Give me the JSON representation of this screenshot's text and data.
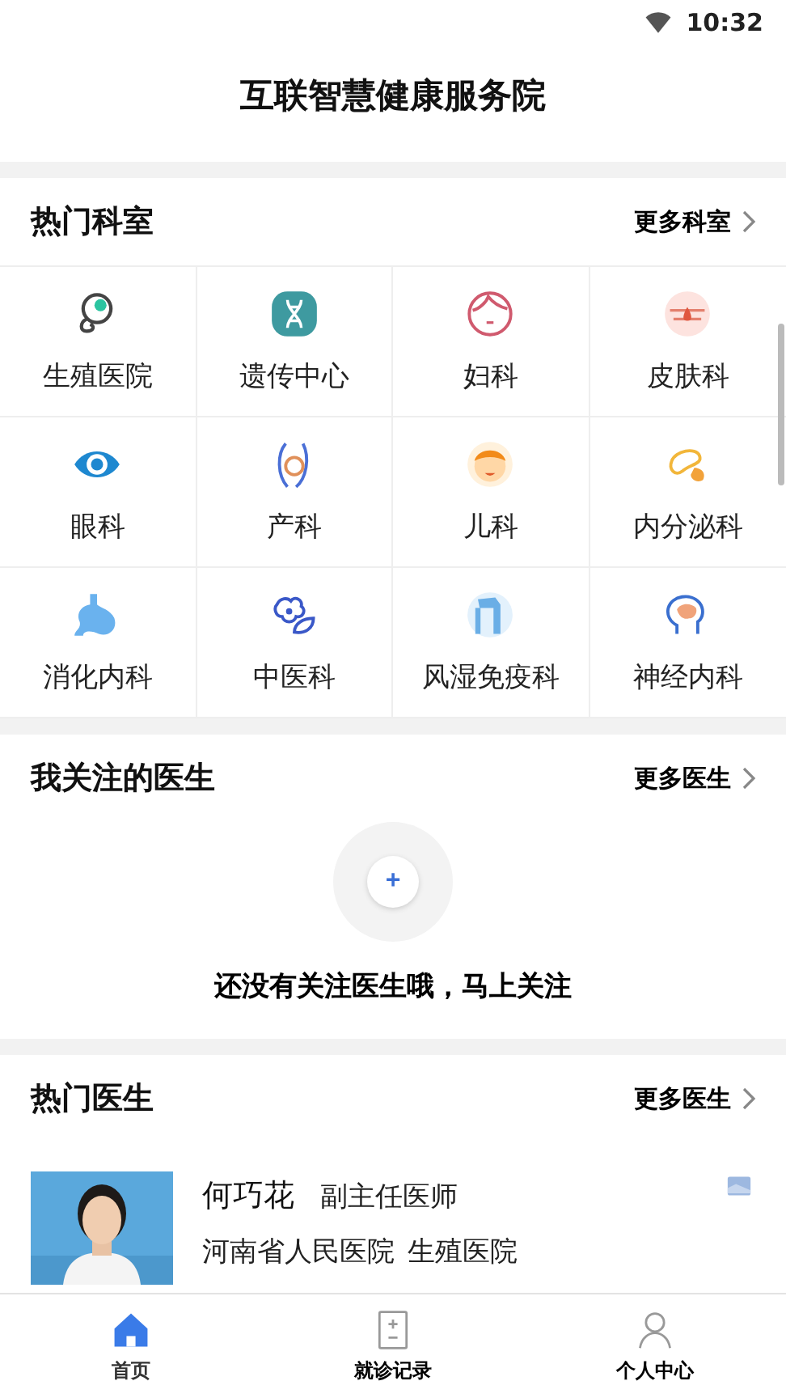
{
  "status_bar": {
    "time": "10:32"
  },
  "header": {
    "title": "互联智慧健康服务院"
  },
  "hot_departments": {
    "title": "热门科室",
    "more": "更多科室",
    "items": [
      {
        "label": "生殖医院"
      },
      {
        "label": "遗传中心"
      },
      {
        "label": "妇科"
      },
      {
        "label": "皮肤科"
      },
      {
        "label": "眼科"
      },
      {
        "label": "产科"
      },
      {
        "label": "儿科"
      },
      {
        "label": "内分泌科"
      },
      {
        "label": "消化内科"
      },
      {
        "label": "中医科"
      },
      {
        "label": "风湿免疫科"
      },
      {
        "label": "神经内科"
      }
    ]
  },
  "followed_doctors": {
    "title": "我关注的医生",
    "more": "更多医生",
    "add_button": "+",
    "empty_text": "还没有关注医生哦，马上关注"
  },
  "hot_doctors": {
    "title": "热门医生",
    "more": "更多医生",
    "doctors": [
      {
        "name": "何巧花",
        "title": "副主任医师",
        "hospital": "河南省人民医院",
        "department": "生殖医院"
      }
    ]
  },
  "bottom_nav": [
    {
      "label": "首页",
      "selected": true
    },
    {
      "label": "就诊记录",
      "selected": false
    },
    {
      "label": "个人中心",
      "selected": false
    }
  ]
}
